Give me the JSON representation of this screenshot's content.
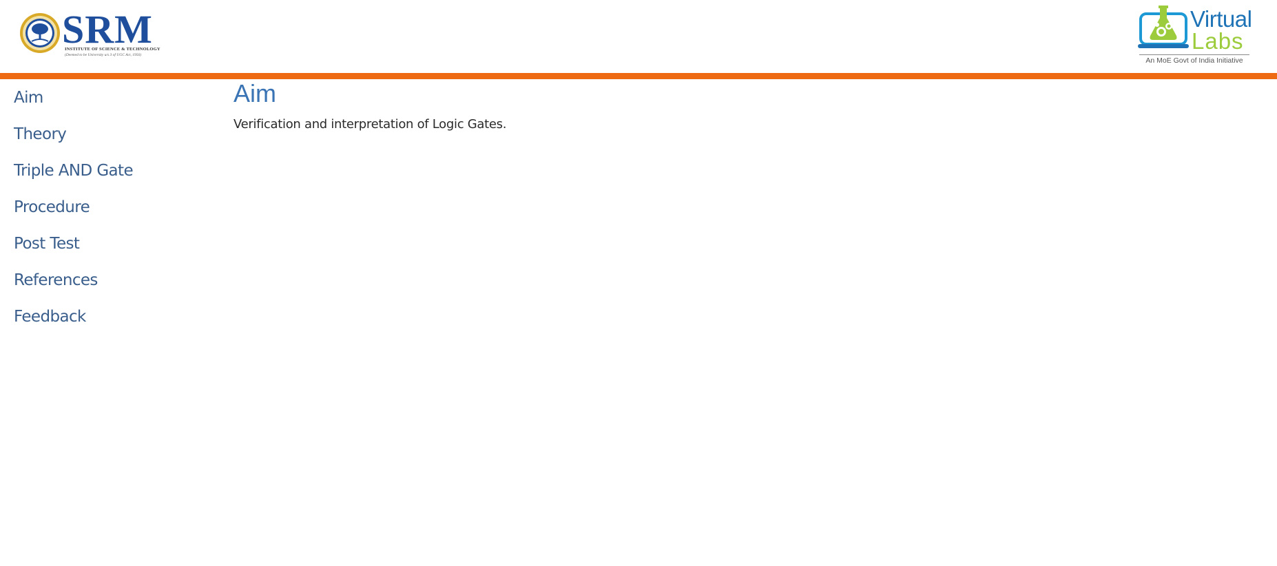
{
  "header": {
    "srm_logo": {
      "name": "SRM",
      "line1": "INSTITUTE OF SCIENCE & TECHNOLOGY",
      "line2": "(Deemed to be University u/s 3 of UGC Act, 1956)"
    },
    "vlabs_logo": {
      "word1": "Virtual",
      "word2": "Labs",
      "tagline": "An MoE Govt of India Initiative"
    },
    "accent_color": "#ee6a12"
  },
  "sidebar": {
    "items": [
      {
        "label": "Aim"
      },
      {
        "label": "Theory"
      },
      {
        "label": "Triple AND Gate"
      },
      {
        "label": "Procedure"
      },
      {
        "label": "Post Test"
      },
      {
        "label": "References"
      },
      {
        "label": "Feedback"
      }
    ],
    "link_color": "#3a5e8c"
  },
  "main": {
    "title": "Aim",
    "body": "Verification and interpretation of Logic Gates."
  }
}
